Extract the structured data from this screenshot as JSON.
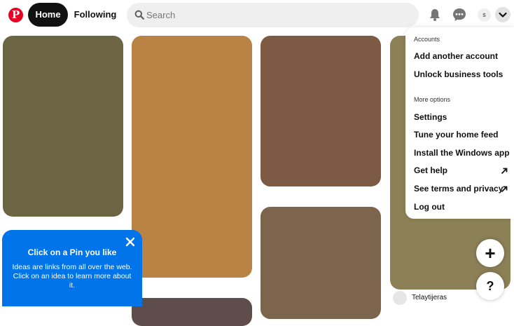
{
  "header": {
    "logo_letter": "P",
    "nav": {
      "home": "Home",
      "following": "Following"
    },
    "search": {
      "placeholder": "Search",
      "value": ""
    },
    "avatar_initial": "s"
  },
  "pins": [
    {
      "color": "#6b6543"
    },
    {
      "color": "#b98346"
    },
    {
      "color": "#7c5a44"
    },
    {
      "color": "#8c8057"
    },
    {
      "color": "#7c644d"
    },
    {
      "color": "#5e4d4a"
    }
  ],
  "pin_user": {
    "name": "Telaytijeras"
  },
  "menu": {
    "accounts_label": "Accounts",
    "add_account": "Add another account",
    "unlock_business": "Unlock business tools",
    "more_options_label": "More options",
    "settings": "Settings",
    "tune_feed": "Tune your home feed",
    "install_app": "Install the Windows app",
    "get_help": "Get help",
    "terms_privacy": "See terms and privacy",
    "log_out": "Log out"
  },
  "tooltip": {
    "title": "Click on a Pin you like",
    "body": "Ideas are links from all over the web. Click on an idea to learn more about it."
  },
  "fab": {
    "create": "+",
    "help": "?"
  },
  "colors": {
    "brand": "#e60023",
    "tooltip_blue": "#0074e8",
    "search_bg": "#efefef"
  }
}
